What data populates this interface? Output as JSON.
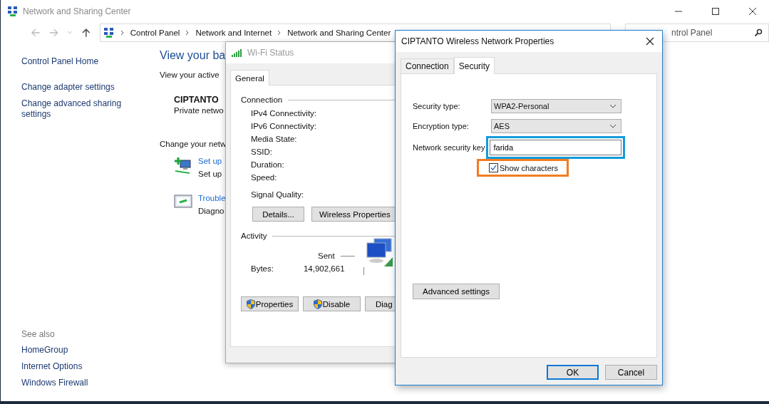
{
  "main_window": {
    "title": "Network and Sharing Center",
    "breadcrumb": [
      "Control Panel",
      "Network and Internet",
      "Network and Sharing Center"
    ],
    "search": {
      "placeholder": "ntrol Panel"
    },
    "sidebar": {
      "links": [
        "Control Panel Home",
        "Change adapter settings",
        "Change advanced sharing settings"
      ],
      "see_also_heading": "See also",
      "see_also": [
        "HomeGroup",
        "Internet Options",
        "Windows Firewall"
      ]
    },
    "content": {
      "heading": "View your ba",
      "subheading": "View your active",
      "network_name": "CIPTANTO",
      "network_type": "Private netwo",
      "change_heading": "Change your netw",
      "tasks": [
        {
          "kind": "setup",
          "link": "Set up",
          "description": "Set up"
        },
        {
          "kind": "troubleshoot",
          "link": "Trouble",
          "description": "Diagno"
        }
      ]
    }
  },
  "wifi_status": {
    "title": "Wi-Fi Status",
    "tabs": [
      {
        "label": "General",
        "selected": true
      }
    ],
    "connection_heading": "Connection",
    "fields": [
      "IPv4 Connectivity:",
      "IPv6 Connectivity:",
      "Media State:",
      "SSID:",
      "Duration:",
      "Speed:"
    ],
    "signal_label": "Signal Quality:",
    "buttons": [
      "Details...",
      "Wireless Properties"
    ],
    "activity_heading": "Activity",
    "sent_label": "Sent",
    "bytes_label": "Bytes:",
    "bytes_sent": "14,902,661",
    "bottom_buttons": [
      {
        "label": "Properties",
        "shield": true
      },
      {
        "label": "Disable",
        "shield": true
      },
      {
        "label": "Diag",
        "shield": false
      }
    ]
  },
  "properties_dialog": {
    "title": "CIPTANTO Wireless Network Properties",
    "tabs": [
      {
        "label": "Connection",
        "selected": false
      },
      {
        "label": "Security",
        "selected": true
      }
    ],
    "selects": [
      {
        "label": "Security type:",
        "value": "WPA2-Personal"
      },
      {
        "label": "Encryption type:",
        "value": "AES"
      }
    ],
    "key": {
      "label": "Network security key",
      "value": "farida",
      "highlighted": true
    },
    "show_characters": {
      "label": "Show characters",
      "checked": true,
      "highlighted": true
    },
    "advanced_button": "Advanced settings",
    "buttons": [
      {
        "label": "OK",
        "default": true
      },
      {
        "label": "Cancel",
        "default": false
      }
    ]
  }
}
